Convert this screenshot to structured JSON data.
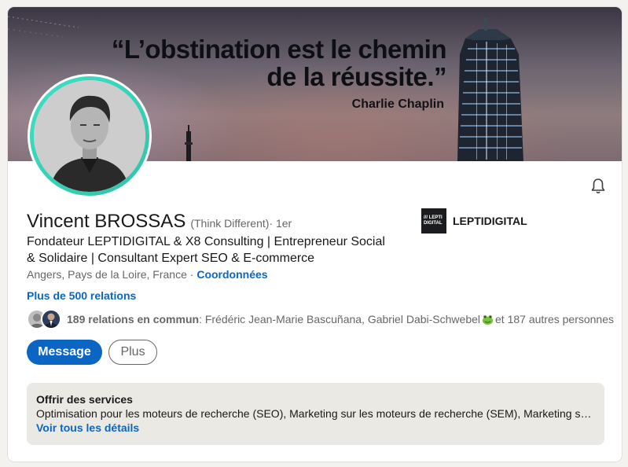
{
  "banner": {
    "quote_line1": "“L’obstination est le chemin",
    "quote_line2": "de la réussite.”",
    "quote_author": "Charlie Chaplin"
  },
  "profile": {
    "name": "Vincent BROSSAS",
    "pronoun": "(Think Different)",
    "degree": " · 1er",
    "headline": "Fondateur LEPTIDIGITAL & X8 Consulting | Entrepreneur Social & Solidaire | Consultant Expert SEO & E-commerce",
    "location": "Angers, Pays de la Loire, France",
    "location_separator": " · ",
    "contact_link": "Coordonnées",
    "relations": "Plus de 500 relations",
    "common_count": "189 relations en commun",
    "common_names": " : Frédéric Jean-Marie Bascuñana, Gabriel Dabi-Schwebel",
    "common_rest": " et 187 autres personnes"
  },
  "company": {
    "logo_line1": "/// LEPTI",
    "logo_line2": "DIGITAL",
    "name": "LEPTIDIGITAL"
  },
  "actions": {
    "message_label": "Message",
    "more_label": "Plus"
  },
  "services": {
    "title": "Offrir des services",
    "list": "Optimisation pour les moteurs de recherche (SEO), Marketing sur les moteurs de recherche (SEM), Marketing sur les réseaux sociaux",
    "link": "Voir tous les détails"
  },
  "icons": {
    "bell": "bell-icon",
    "frog": "frog-emoji-icon"
  },
  "colors": {
    "accent": "#0a66c2",
    "avatar_ring": "#3fe0c6",
    "services_bg": "#ebe9e4"
  }
}
